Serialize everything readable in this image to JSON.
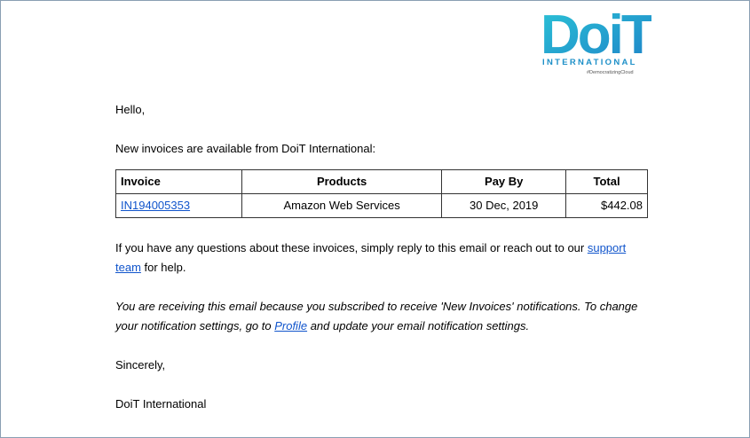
{
  "brand": {
    "logo_word": "DoiT",
    "logo_sub": "INTERNATIONAL",
    "logo_tag": "#DemocratizingCloud",
    "color_primary": "#1e90c8",
    "color_gradient_start": "#2bc3d6"
  },
  "email": {
    "greeting": "Hello,",
    "intro": "New invoices are available from DoiT International:",
    "table": {
      "headers": [
        "Invoice",
        "Products",
        "Pay By",
        "Total"
      ],
      "rows": [
        {
          "invoice": "IN194005353",
          "product": "Amazon Web Services",
          "pay_by": "30 Dec, 2019",
          "total": "$442.08"
        }
      ]
    },
    "questions_pre": "If you have any questions about these invoices, simply reply to this email or reach out to our ",
    "support_link": "support team",
    "questions_post": " for help.",
    "notice_pre": "You are receiving this email because you subscribed to receive 'New Invoices' notifications. To change your notification settings, go to ",
    "profile_link": "Profile",
    "notice_post": " and update your email notification settings.",
    "closing": "Sincerely,",
    "signature": "DoiT International"
  }
}
